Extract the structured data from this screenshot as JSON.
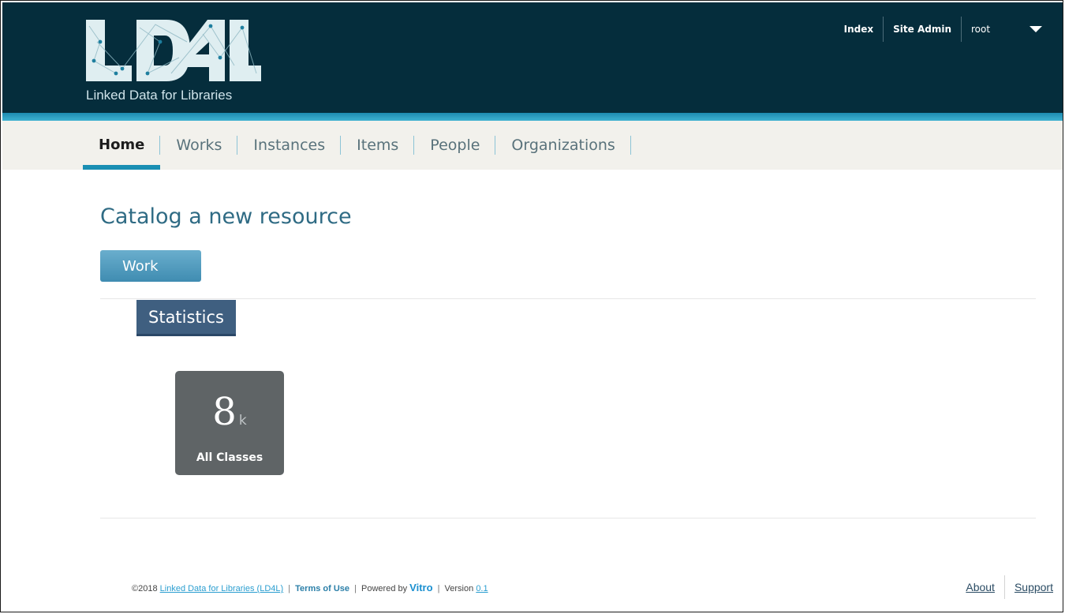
{
  "header": {
    "logo_text": "LD4L",
    "tagline": "Linked Data for Libraries",
    "user_menu": {
      "index_label": "Index",
      "site_admin_label": "Site Admin",
      "user_label": "root"
    },
    "colors": {
      "background": "#052d3c",
      "accent_stripe": "#2ea3c6"
    }
  },
  "nav": {
    "items": [
      {
        "label": "Home",
        "active": true
      },
      {
        "label": "Works"
      },
      {
        "label": "Instances"
      },
      {
        "label": "Items"
      },
      {
        "label": "People"
      },
      {
        "label": "Organizations"
      }
    ]
  },
  "main": {
    "title": "Catalog a new resource",
    "work_button_label": "Work",
    "statistics": {
      "heading": "Statistics",
      "tiles": [
        {
          "value": "8",
          "unit": "k",
          "label": "All Classes"
        }
      ]
    }
  },
  "footer": {
    "copyright": "©2018",
    "org_link": "Linked Data for Libraries (LD4L)",
    "terms_link": "Terms of Use",
    "powered_by": "Powered by",
    "vitro_link": "Vitro",
    "version_label": "Version",
    "version_link": "0.1",
    "separator": "|",
    "about_link": "About",
    "support_link": "Support"
  }
}
